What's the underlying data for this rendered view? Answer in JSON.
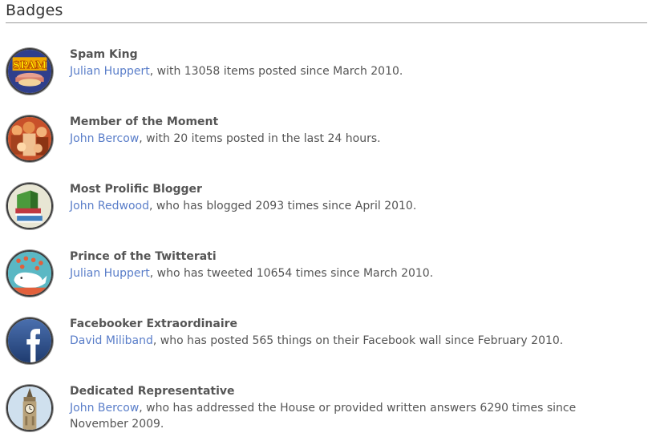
{
  "section": {
    "title": "Badges"
  },
  "badges": [
    {
      "icon": "spam-can-icon",
      "title": "Spam King",
      "person": "Julian Huppert",
      "text": ", with 13058 items posted since March 2010.",
      "colors": {
        "ring": "#2f3f8c",
        "accent": "#f0a800"
      }
    },
    {
      "icon": "crowd-photo-icon",
      "title": "Member of the Moment",
      "person": "John Bercow",
      "text": ", with 20 items posted in the last 24 hours.",
      "colors": {
        "ring": "#c8502a",
        "accent": "#f2a868"
      }
    },
    {
      "icon": "books-icon",
      "title": "Most Prolific Blogger",
      "person": "John Redwood",
      "text": ", who has blogged 2093 times since April 2010.",
      "colors": {
        "ring": "#e8e6d4",
        "accent": "#4a9a3c"
      }
    },
    {
      "icon": "twitter-whale-icon",
      "title": "Prince of the Twitterati",
      "person": "Julian Huppert",
      "text": ", who has tweeted 10654 times since March 2010.",
      "colors": {
        "ring": "#5ab8c4",
        "accent": "#e2603c"
      }
    },
    {
      "icon": "facebook-icon",
      "title": "Facebooker Extraordinaire",
      "person": "David Miliband",
      "text": ", who has posted 565 things on their Facebook wall since February 2010.",
      "colors": {
        "ring": "#2c4f86",
        "accent": "#ffffff"
      }
    },
    {
      "icon": "big-ben-icon",
      "title": "Dedicated Representative",
      "person": "John Bercow",
      "text": ", who has addressed the House or provided written answers 6290 times since November 2009.",
      "colors": {
        "ring": "#cfe0ee",
        "accent": "#b8a27a"
      }
    }
  ]
}
